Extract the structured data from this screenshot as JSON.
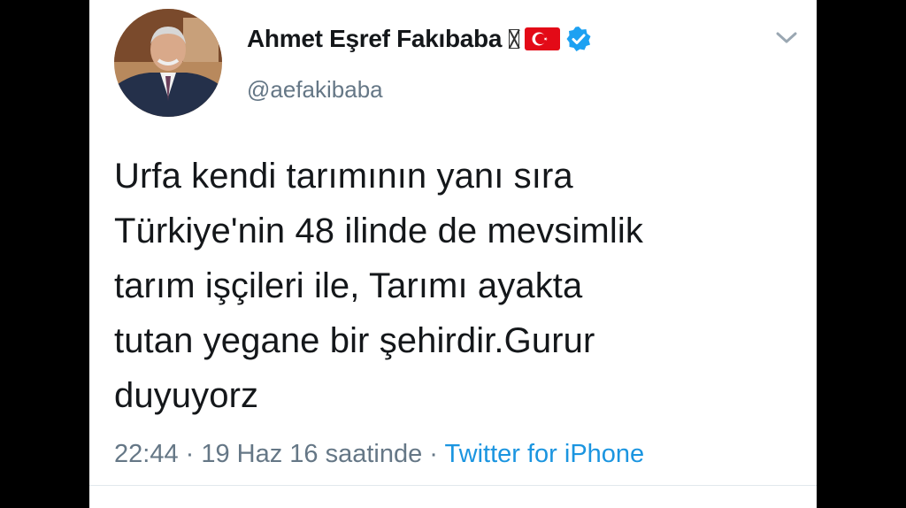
{
  "tweet": {
    "author": {
      "display_name": "Ahmet Eşref Fakıbaba",
      "handle": "@aefakibaba",
      "verified": true,
      "flag_icon": "turkey-flag-icon",
      "unknown_glyph_icon": "missing-glyph-icon",
      "avatar_icon": "profile-photo-avatar"
    },
    "text_lines": [
      "Urfa kendi tarımının yanı sıra",
      "Türkiye'nin 48 ilinde de mevsimlik",
      "tarım işçileri ile, Tarımı ayakta",
      "tutan yegane bir şehirdir.Gurur",
      "duyuyorz"
    ],
    "meta": {
      "time_and_date": "22:44 · 19 Haz 16 saatinde ·",
      "source": "Twitter for iPhone"
    },
    "menu_icon": "chevron-down-icon"
  },
  "colors": {
    "text_primary": "#14171a",
    "text_secondary": "#657786",
    "link": "#1b95e0",
    "verified_badge": "#1da1f2",
    "flag_red": "#e30a17"
  }
}
